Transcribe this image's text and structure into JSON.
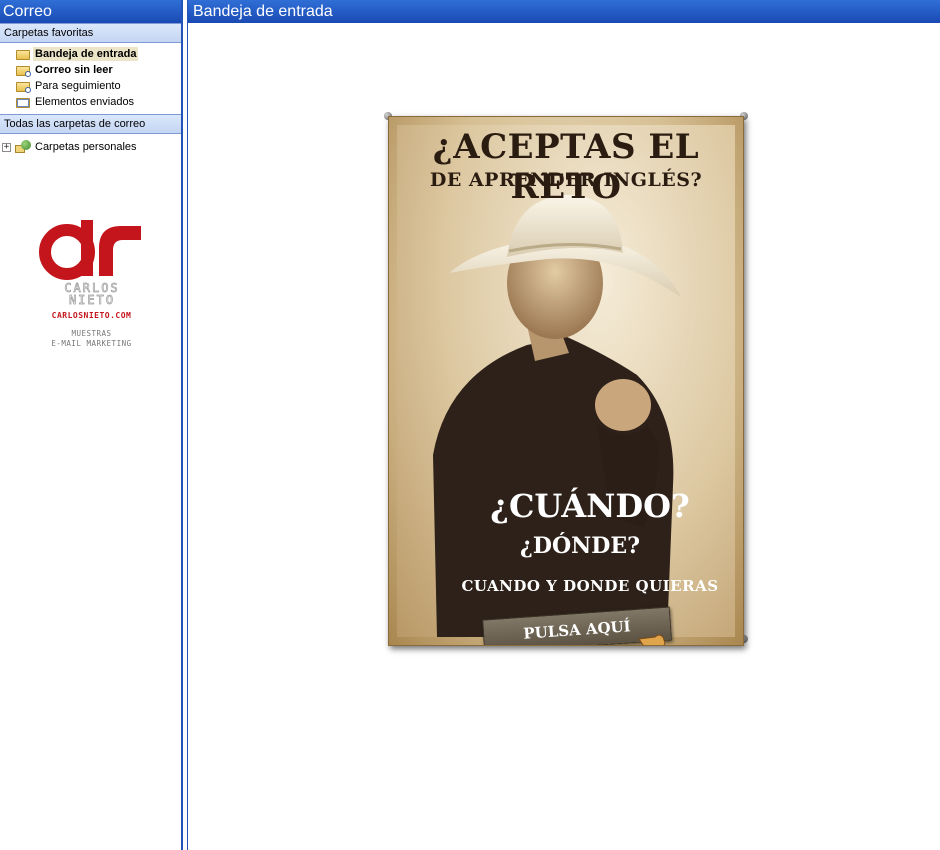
{
  "nav": {
    "title": "Correo",
    "favorites_header": "Carpetas favoritas",
    "favorites": [
      {
        "label": "Bandeja de entrada",
        "icon": "inbox-folder-icon"
      },
      {
        "label": "Correo sin leer",
        "icon": "search-folder-icon"
      },
      {
        "label": "Para seguimiento",
        "icon": "search-folder-icon"
      },
      {
        "label": "Elementos enviados",
        "icon": "sent-folder-icon"
      }
    ],
    "all_folders_header": "Todas las carpetas de correo",
    "tree": [
      {
        "label": "Carpetas personales",
        "icon": "personal-folders-icon",
        "expander": "+"
      }
    ]
  },
  "brand": {
    "logo_text": "CARLOS NIETO",
    "url": "CARLOSNIETO.COM",
    "tagline_line1": "MUESTRAS",
    "tagline_line2": "E-MAIL MARKETING",
    "accent_color": "#c4151c"
  },
  "main": {
    "title": "Bandeja de entrada",
    "poster": {
      "headline": "¿ACEPTAS EL RETO",
      "subheadline": "DE APRENDER INGLÉS?",
      "question_1": "¿CUÁNDO?",
      "question_2": "¿DÓNDE?",
      "tagline": "CUANDO Y DONDE QUIERAS",
      "cta_label": "PULSA AQUÍ"
    }
  },
  "colors": {
    "header_blue": "#1a4ab4",
    "section_header": "#c4d6f4",
    "selected_folder": "#ece5c8"
  }
}
